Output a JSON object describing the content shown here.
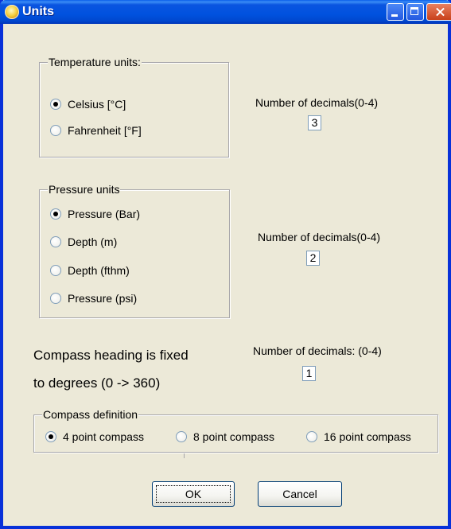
{
  "window": {
    "title": "Units"
  },
  "temperature": {
    "group_label": "Temperature units:",
    "options": [
      "Celsius [°C]",
      "Fahrenheit [°F]"
    ],
    "selected": "Celsius [°C]",
    "decimals_label": "Number of decimals(0-4)",
    "decimals_value": "3"
  },
  "pressure": {
    "group_label": "Pressure units",
    "options": [
      "Pressure (Bar)",
      "Depth (m)",
      "Depth (fthm)",
      "Pressure (psi)"
    ],
    "selected": "Pressure (Bar)",
    "decimals_label": "Number of decimals(0-4)",
    "decimals_value": "2"
  },
  "compass": {
    "note_line1": "Compass heading is fixed",
    "note_line2": "to degrees (0 -> 360)",
    "decimals_label": "Number of decimals:  (0-4)",
    "decimals_value": "1",
    "group_label": "Compass definition",
    "options": [
      "4 point compass",
      "8 point compass",
      "16 point compass"
    ],
    "selected": "4 point compass"
  },
  "buttons": {
    "ok_label": "OK",
    "cancel_label": "Cancel"
  }
}
